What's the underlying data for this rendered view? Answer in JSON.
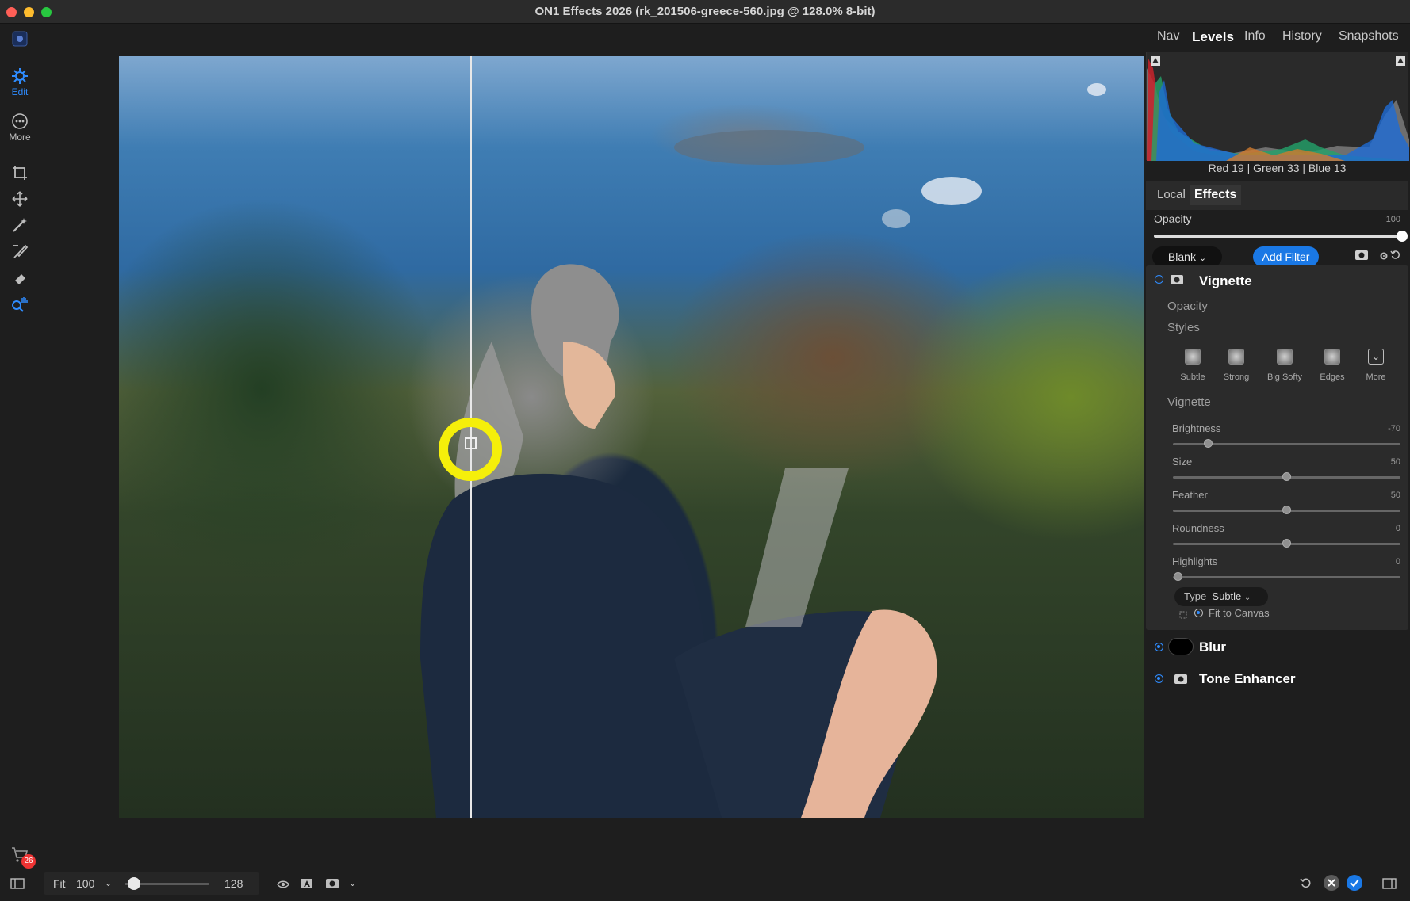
{
  "window": {
    "title": "ON1 Effects 2026 (rk_201506-greece-560.jpg @ 128.0% 8-bit)"
  },
  "leftbar": {
    "edit_label": "Edit",
    "more_label": "More",
    "cart_count": "26"
  },
  "right_tabs": [
    "Nav",
    "Levels",
    "Info",
    "History",
    "Snapshots"
  ],
  "histogram": {
    "readout": "Red  19  | Green  33  | Blue  13"
  },
  "subtabs": {
    "local": "Local",
    "effects": "Effects"
  },
  "opacity": {
    "label": "Opacity",
    "value": "100"
  },
  "filter_bar": {
    "preset": "Blank",
    "add_filter": "Add Filter"
  },
  "vignette": {
    "title": "Vignette",
    "opacity_label": "Opacity",
    "styles_label": "Styles",
    "styles": [
      "Subtle",
      "Strong",
      "Big Softy",
      "Edges",
      "More"
    ],
    "section": "Vignette",
    "sliders": [
      {
        "label": "Brightness",
        "value": "-70"
      },
      {
        "label": "Size",
        "value": "50"
      },
      {
        "label": "Feather",
        "value": "50"
      },
      {
        "label": "Roundness",
        "value": "0"
      },
      {
        "label": "Highlights",
        "value": "0"
      }
    ],
    "type_label": "Type",
    "type_value": "Subtle",
    "fit_to_canvas": "Fit to Canvas"
  },
  "blur": {
    "title": "Blur"
  },
  "tone": {
    "title": "Tone Enhancer"
  },
  "bottom": {
    "fit": "Fit",
    "zoom_value": "100",
    "zoom_max": "128"
  }
}
